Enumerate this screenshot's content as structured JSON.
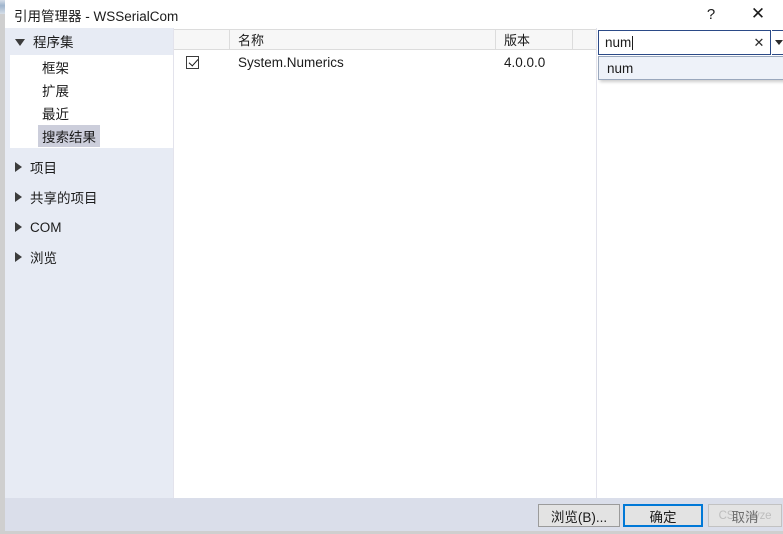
{
  "window": {
    "title": "引用管理器 - WSSerialCom",
    "help_icon": "?",
    "close_icon": "✕"
  },
  "nav": {
    "groups": [
      {
        "label": "程序集",
        "expanded": true,
        "items": [
          {
            "label": "框架",
            "selected": false
          },
          {
            "label": "扩展",
            "selected": false
          },
          {
            "label": "最近",
            "selected": false
          },
          {
            "label": "搜索结果",
            "selected": true
          }
        ]
      },
      {
        "label": "项目",
        "expanded": false
      },
      {
        "label": "共享的项目",
        "expanded": false
      },
      {
        "label": "COM",
        "expanded": false
      },
      {
        "label": "浏览",
        "expanded": false
      }
    ]
  },
  "list": {
    "columns": [
      "",
      "名称",
      "版本",
      ""
    ],
    "rows": [
      {
        "checked": true,
        "name": "System.Numerics",
        "version": "4.0.0.0"
      }
    ]
  },
  "search": {
    "value": "num",
    "clear_icon": "✕",
    "dropdown_icon": "chevron-down-icon",
    "suggestions": [
      "num"
    ]
  },
  "footer": {
    "browse_label": "浏览(B)...",
    "ok_label": "确定",
    "cancel_label": "取消",
    "cancel_watermark": "CS…alyze"
  },
  "colors": {
    "nav_background": "#e7ebf4",
    "footer_background": "#dadeea",
    "selection": "#cccedb",
    "focus_border": "#2b4a87",
    "default_button_border": "#0078d7"
  }
}
